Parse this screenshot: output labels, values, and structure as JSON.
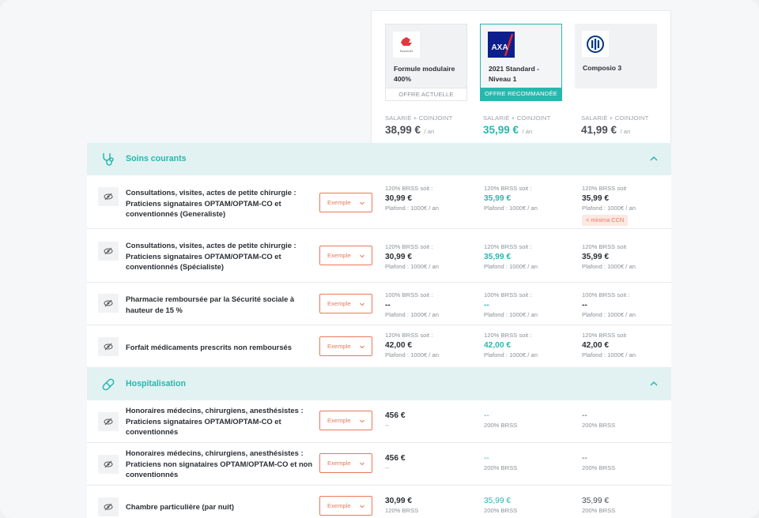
{
  "offers": [
    {
      "logo": "SwissLife",
      "name": "Formule modulaire 400%",
      "tag": "OFFRE ACTUELLE",
      "price_label": "SALARIÉ + COINJOINT",
      "price": "38,99 €",
      "unit": "/ an"
    },
    {
      "logo": "AXA",
      "name": "2021 Standard - Niveau 1",
      "tag": "OFFRE RECOMMANDÉE",
      "price_label": "SALARIÉ + COINJOINT",
      "price": "35,99 €",
      "unit": "/ an"
    },
    {
      "logo": "Allianz",
      "name": "Composio 3",
      "tag": "",
      "price_label": "SALARIÉ + COINJOINT",
      "price": "41,99 €",
      "unit": "/ an"
    }
  ],
  "colors": {
    "accent": "#27b7ad",
    "warning": "#e9795a",
    "section_bg": "#e2f2f2"
  },
  "sections": [
    {
      "title": "Soins courants",
      "icon": "stethoscope-icon",
      "rows": [
        {
          "label": "Consultations, visites, actes de petite chirurgie : Praticiens signataires OPTAM/OPTAM-CO et conventionnés (Generaliste)",
          "dropdown": "Exemple",
          "cells": [
            {
              "top": "120% BRSS soit :",
              "value": "30,99 €",
              "bottom": "Plafond : 1000€ / an"
            },
            {
              "top": "120% BRSS soit :",
              "value": "35,99 €",
              "bottom": "Plafond : 1000€ / an"
            },
            {
              "top": "120% BRSS soit",
              "value": "35,99 €",
              "bottom": "Plafond : 1000€ / an",
              "badge": "< minima CCN"
            }
          ]
        },
        {
          "label": "Consultations, visites, actes de petite chirurgie : Praticiens signataires OPTAM/OPTAM-CO et conventionnés (Spécialiste)",
          "dropdown": "Exemple",
          "cells": [
            {
              "top": "120% BRSS soit :",
              "value": "30,99 €",
              "bottom": "Plafond : 1000€ / an"
            },
            {
              "top": "120% BRSS soit :",
              "value": "35,99 €",
              "bottom": "Plafond : 1000€ / an"
            },
            {
              "top": "120% BRSS soit",
              "value": "35,99 €",
              "bottom": "Plafond : 1000€ / an"
            }
          ]
        },
        {
          "label": "Pharmacie remboursée par la Sécurité sociale à hauteur de 15 %",
          "dropdown": "Exemple",
          "cells": [
            {
              "top": "100% BRSS soit :",
              "value": "--",
              "bottom": "Plafond : 1000€ / an"
            },
            {
              "top": "100% BRSS soit :",
              "value": "--",
              "bottom": "Plafond : 1000€ / an"
            },
            {
              "top": "100% BRSS soit :",
              "value": "--",
              "bottom": "Plafond : 1000€ / an"
            }
          ]
        },
        {
          "label": "Forfait médicaments prescrits non remboursés",
          "dropdown": "Exemple",
          "cells": [
            {
              "top": "120% BRSS soit :",
              "value": "42,00 €",
              "bottom": "Plafond : 1000€ / an"
            },
            {
              "top": "120% BRSS soit :",
              "value": "42,00 €",
              "bottom": "Plafond : 1000€ / an"
            },
            {
              "top": "120% BRSS soit",
              "value": "42,00 €",
              "bottom": "Plafond : 1000€ / an"
            }
          ]
        }
      ]
    },
    {
      "title": "Hospitalisation",
      "icon": "pill-icon",
      "rows": [
        {
          "label": "Honoraires médecins, chirurgiens, anesthésistes : Praticiens signataires OPTAM/OPTAM-CO et conventionnés",
          "dropdown": "Exemple",
          "cells": [
            {
              "value": "456 €",
              "bottom": "--"
            },
            {
              "value": "--",
              "bottom": "200% BRSS"
            },
            {
              "value": "--",
              "bottom": "200% BRSS"
            }
          ]
        },
        {
          "label": "Honoraires médecins, chirurgiens, anesthésistes : Praticiens non signataires OPTAM/OPTAM-CO et non conventionnés",
          "dropdown": "Exemple",
          "cells": [
            {
              "value": "456 €",
              "bottom": "--"
            },
            {
              "value": "--",
              "bottom": "200% BRSS"
            },
            {
              "value": "--",
              "bottom": "200% BRSS"
            }
          ]
        },
        {
          "label": "Chambre particulière (par nuit)",
          "dropdown": "Exemple",
          "cells": [
            {
              "value": "30,99 €",
              "bottom": "120% BRSS"
            },
            {
              "value": "35,99 €",
              "bottom": "200% BRSS"
            },
            {
              "value": "35,99 €",
              "bottom": "200% BRSS"
            }
          ]
        }
      ]
    }
  ]
}
